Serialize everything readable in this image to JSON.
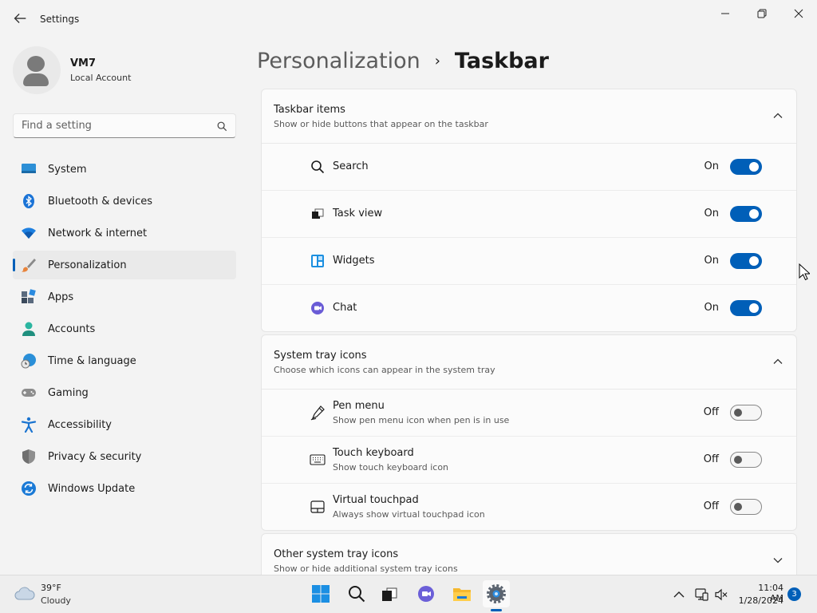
{
  "window": {
    "title": "Settings",
    "back_icon": "back-arrow-icon",
    "controls": [
      "minimize-icon",
      "restore-icon",
      "close-icon"
    ]
  },
  "profile": {
    "name": "VM7",
    "account_type": "Local Account"
  },
  "search": {
    "placeholder": "Find a setting",
    "value": ""
  },
  "sidebar": {
    "items": [
      {
        "label": "System",
        "icon": "system-display-icon"
      },
      {
        "label": "Bluetooth & devices",
        "icon": "bluetooth-icon"
      },
      {
        "label": "Network & internet",
        "icon": "wifi-icon"
      },
      {
        "label": "Personalization",
        "icon": "paintbrush-icon",
        "selected": true
      },
      {
        "label": "Apps",
        "icon": "apps-icon"
      },
      {
        "label": "Accounts",
        "icon": "accounts-icon"
      },
      {
        "label": "Time & language",
        "icon": "globe-clock-icon"
      },
      {
        "label": "Gaming",
        "icon": "gamepad-icon"
      },
      {
        "label": "Accessibility",
        "icon": "accessibility-icon"
      },
      {
        "label": "Privacy & security",
        "icon": "shield-icon"
      },
      {
        "label": "Windows Update",
        "icon": "update-icon"
      }
    ]
  },
  "breadcrumb": {
    "parent": "Personalization",
    "separator": "›",
    "current": "Taskbar"
  },
  "sections": {
    "taskbar_items": {
      "title": "Taskbar items",
      "subtitle": "Show or hide buttons that appear on the taskbar",
      "expanded": true,
      "rows": [
        {
          "label": "Search",
          "state": "On",
          "on": true,
          "icon": "search-icon"
        },
        {
          "label": "Task view",
          "state": "On",
          "on": true,
          "icon": "task-view-icon"
        },
        {
          "label": "Widgets",
          "state": "On",
          "on": true,
          "icon": "widgets-icon"
        },
        {
          "label": "Chat",
          "state": "On",
          "on": true,
          "icon": "chat-icon"
        }
      ]
    },
    "system_tray_icons": {
      "title": "System tray icons",
      "subtitle": "Choose which icons can appear in the system tray",
      "expanded": true,
      "rows": [
        {
          "label": "Pen menu",
          "sublabel": "Show pen menu icon when pen is in use",
          "state": "Off",
          "on": false,
          "icon": "pen-icon"
        },
        {
          "label": "Touch keyboard",
          "sublabel": "Show touch keyboard icon",
          "state": "Off",
          "on": false,
          "icon": "keyboard-icon"
        },
        {
          "label": "Virtual touchpad",
          "sublabel": "Always show virtual touchpad icon",
          "state": "Off",
          "on": false,
          "icon": "touchpad-icon"
        }
      ]
    },
    "other_tray_icons": {
      "title": "Other system tray icons",
      "subtitle": "Show or hide additional system tray icons",
      "expanded": false
    }
  },
  "taskbar": {
    "weather": {
      "temp": "39°F",
      "condition": "Cloudy",
      "icon": "cloud-icon"
    },
    "apps": [
      "windows-start-icon",
      "search-icon",
      "task-view-icon",
      "teams-chat-icon",
      "file-explorer-icon",
      "settings-gear-icon"
    ],
    "active_app": "settings-gear-icon",
    "tray": [
      "chevron-up-icon",
      "network-icon",
      "volume-muted-icon"
    ],
    "clock": {
      "time": "11:04 AM",
      "date": "1/28/2024"
    },
    "notifications": "3"
  },
  "colors": {
    "accent": "#005fb8",
    "background": "#f3f3f3",
    "card": "#fbfbfb"
  }
}
